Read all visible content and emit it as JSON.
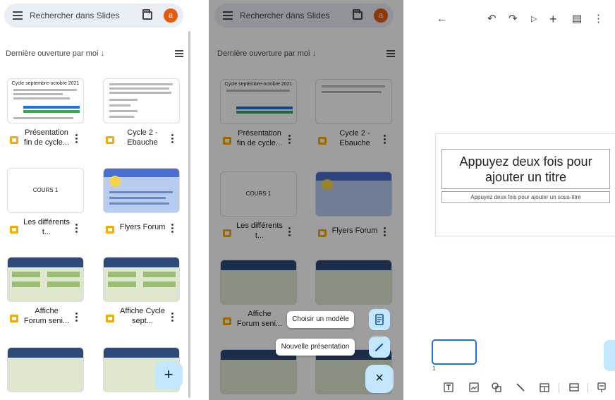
{
  "library": {
    "search_placeholder": "Rechercher dans Slides",
    "avatar_letter": "a",
    "sort_label": "Dernière ouverture par moi ↓",
    "files": [
      {
        "title": "Présentation fin de cycle...",
        "thumb_caption": "Cycle septembre-octobre 2021"
      },
      {
        "title": "Cycle 2 -Ebauche",
        "thumb_caption": ""
      },
      {
        "title": "Les différents t...",
        "thumb_caption": "COURS 1"
      },
      {
        "title": "Flyers Forum",
        "thumb_caption": ""
      },
      {
        "title": "Affiche Forum seni...",
        "thumb_caption": ""
      },
      {
        "title": "Affiche Cycle sept...",
        "thumb_caption": ""
      }
    ],
    "fab_label": "+"
  },
  "overlay": {
    "template_label": "Choisir un modèle",
    "new_label": "Nouvelle présentation",
    "close_label": "×"
  },
  "editor": {
    "title_placeholder": "Appuyez deux fois pour ajouter un titre",
    "subtitle_placeholder": "Appuyez deux fois pour ajouter un sous-titre",
    "slide_number": "1"
  },
  "colors": {
    "accent": "#1a73e8",
    "fab": "#c2e7ff",
    "slides_yellow": "#f9ab00",
    "avatar": "#e8590c"
  }
}
